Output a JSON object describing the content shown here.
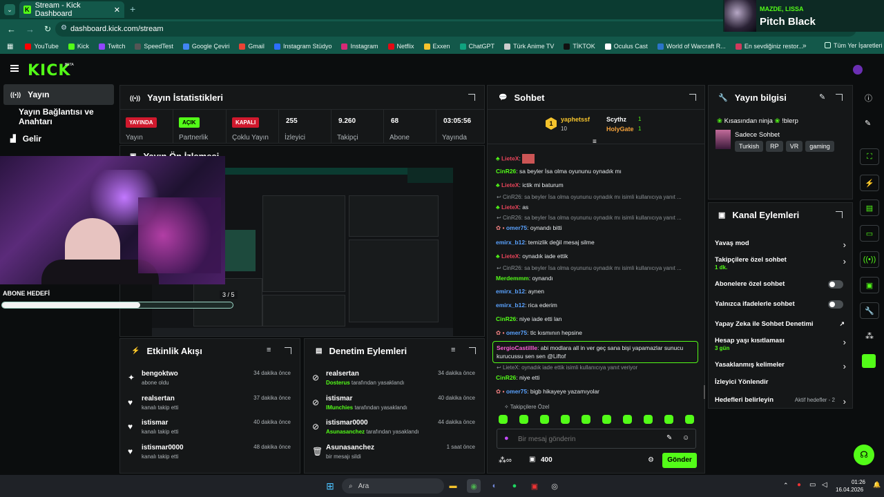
{
  "browser": {
    "tab_title": "Stream - Kick Dashboard",
    "url": "dashboard.kick.com/stream",
    "bookmarks": [
      "YouTube",
      "Kick",
      "Twitch",
      "SpeedTest",
      "Google Çeviri",
      "Gmail",
      "Instagram Stüdyo",
      "Instagram",
      "Netflix",
      "Exxen",
      "ChatGPT",
      "Türk Anime TV",
      "TİKTOK",
      "Oculus Cast",
      "World of Warcraft R...",
      "En sevdiğiniz restor..."
    ],
    "all_bookmarks": "Tüm Yer İşaretleri"
  },
  "media": {
    "artist": "MAZDE, LISSA",
    "track": "Pitch Black"
  },
  "app": {
    "logo": "KICK",
    "logo_sup": "BETA"
  },
  "sidebar": {
    "items": [
      "Yayın",
      "Yayın Bağlantısı ve Anahtarı",
      "Gelir"
    ]
  },
  "stats": {
    "title": "Yayın İstatistikleri",
    "items": [
      {
        "badge": "YAYINDA",
        "label": "Yayın",
        "color": "#d0192d"
      },
      {
        "badge": "AÇIK",
        "label": "Partnerlik",
        "color": "#53fc18"
      },
      {
        "badge": "KAPALI",
        "label": "Çoklu Yayın",
        "color": "#d0192d"
      },
      {
        "value": "255",
        "label": "İzleyici"
      },
      {
        "value": "9.260",
        "label": "Takipçi"
      },
      {
        "value": "68",
        "label": "Abone"
      },
      {
        "value": "03:05:56",
        "label": "Yayında"
      }
    ]
  },
  "preview": {
    "title": "Yayın Ön İzlemesi",
    "page": "3 / 5"
  },
  "webcam": {
    "goal_label": "ABONE HEDEFİ",
    "goal_progress": 0.6
  },
  "activity": {
    "title": "Etkinlik Akışı",
    "rows": [
      {
        "name": "bengoktwo",
        "sub": "abone oldu",
        "time": "34 dakika önce"
      },
      {
        "name": "realsertan",
        "sub": "kanalı takip etti",
        "time": "37 dakika önce"
      },
      {
        "name": "istismar",
        "sub": "kanalı takip etti",
        "time": "40 dakika önce"
      },
      {
        "name": "istismar0000",
        "sub": "kanalı takip etti",
        "time": "48 dakika önce"
      }
    ]
  },
  "moderation": {
    "title": "Denetim Eylemleri",
    "rows": [
      {
        "name": "realsertan",
        "by": "Dosterus",
        "action": " tarafından yasaklandı",
        "time": "34 dakika önce"
      },
      {
        "name": "istismar",
        "by": "IMunchies",
        "action": " tarafından yasaklandı",
        "time": "40 dakika önce"
      },
      {
        "name": "istismar0000",
        "by": "Asunasanchez",
        "action": " tarafından yasaklandı",
        "time": "44 dakika önce"
      },
      {
        "name": "Asunasanchez",
        "by": "",
        "action": "bir mesajı sildi",
        "time": "1 saat önce"
      }
    ]
  },
  "chat": {
    "title": "Sohbet",
    "gifters": [
      {
        "name": "yaphetssf",
        "count": "10"
      },
      {
        "name": "Scythz",
        "count": "1"
      },
      {
        "name": "HolyGate",
        "count": "1"
      }
    ],
    "messages": [
      {
        "type": "msg",
        "user": "LieteX",
        "color": "#e8445a",
        "text": ""
      },
      {
        "type": "msg",
        "user": "CinR26",
        "color": "#53fc18",
        "text": "sa beyler İsa olma oyununu oynadık mı"
      },
      {
        "type": "msg",
        "user": "LieteX",
        "color": "#e8445a",
        "text": "ictik mi baturum"
      },
      {
        "type": "reply",
        "text": "CinR26: sa beyler İsa olma oyununu oynadık mı isimli kullanıcıya yanıt ..."
      },
      {
        "type": "msg",
        "user": "LieteX",
        "color": "#e8445a",
        "text": "as"
      },
      {
        "type": "reply",
        "text": "CinR26: sa beyler İsa olma oyununu oynadık mı isimli kullanıcıya yanıt ..."
      },
      {
        "type": "msg",
        "user": "omer75",
        "color": "#5aa2ff",
        "text": "oynandı bitti"
      },
      {
        "type": "msg",
        "user": "emirx_b12",
        "color": "#5aa2ff",
        "text": "temizlik değil mesaj silme"
      },
      {
        "type": "msg",
        "user": "LieteX",
        "color": "#e8445a",
        "text": "oynadık iade ettik"
      },
      {
        "type": "reply",
        "text": "CinR26: sa beyler İsa olma oyununu oynadık mı isimli kullanıcıya yanıt ..."
      },
      {
        "type": "msg",
        "user": "Merdemmm",
        "color": "#53fc18",
        "text": "oynandı"
      },
      {
        "type": "msg",
        "user": "emirx_b12",
        "color": "#5aa2ff",
        "text": "aynen"
      },
      {
        "type": "msg",
        "user": "emirx_b12",
        "color": "#5aa2ff",
        "text": "rica ederim"
      },
      {
        "type": "msg",
        "user": "CinR26",
        "color": "#53fc18",
        "text": "niye iade etti lan"
      },
      {
        "type": "msg",
        "user": "omer75",
        "color": "#5aa2ff",
        "text": "tlc kısmının hepsine"
      },
      {
        "type": "hl",
        "user": "SergioCastillle",
        "color": "#ff5fd8",
        "text": "abi modlara all in ver geç sana bişi yapamazlar sunucu kurucussu sen sen @Liftof"
      },
      {
        "type": "reply",
        "text": "LieteX: oynadık iade ettik isimli kullanıcıya yanıt veriyor"
      },
      {
        "type": "msg",
        "user": "CinR26",
        "color": "#53fc18",
        "text": "niye etti"
      },
      {
        "type": "msg",
        "user": "omer75",
        "color": "#5aa2ff",
        "text": "bigb hikayeye yazamıyolar"
      }
    ],
    "followers_only": "Takipçilere Özel",
    "placeholder": "Bir mesaj gönderin",
    "points": "400",
    "send": "Gönder"
  },
  "stream_info": {
    "title": "Yayın bilgisi",
    "stream_title": "Kısasından ninja",
    "command": "!blerp",
    "category": "Sadece Sohbet",
    "tags": [
      "Turkish",
      "RP",
      "VR",
      "gaming"
    ]
  },
  "channel_actions": {
    "title": "Kanal Eylemleri",
    "rows": [
      {
        "label": "Yavaş mod",
        "kind": "chev"
      },
      {
        "label": "Takipçilere özel sohbet",
        "sub": "1 dk.",
        "kind": "chev"
      },
      {
        "label": "Abonelere özel sohbet",
        "kind": "toggle"
      },
      {
        "label": "Yalnızca ifadelerle sohbet",
        "kind": "toggle"
      },
      {
        "label": "Yapay Zeka ile Sohbet Denetimi",
        "kind": "ext"
      },
      {
        "label": "Hesap yaşı kısıtlaması",
        "sub": "3 gün",
        "kind": "chev"
      },
      {
        "label": "Yasaklanmış kelimeler",
        "kind": "chev"
      },
      {
        "label": "İzleyici Yönlendir",
        "kind": "none"
      },
      {
        "label": "Hedefleri belirleyin",
        "extra": "Aktif hedefler - 2",
        "kind": "chev"
      }
    ]
  },
  "taskbar": {
    "search": "Ara",
    "time": "01:26",
    "date": "16.04.2026"
  },
  "colors": {
    "accent": "#53fc18",
    "panel": "#151718",
    "bg": "#0b0d0e",
    "live": "#d0192d"
  }
}
